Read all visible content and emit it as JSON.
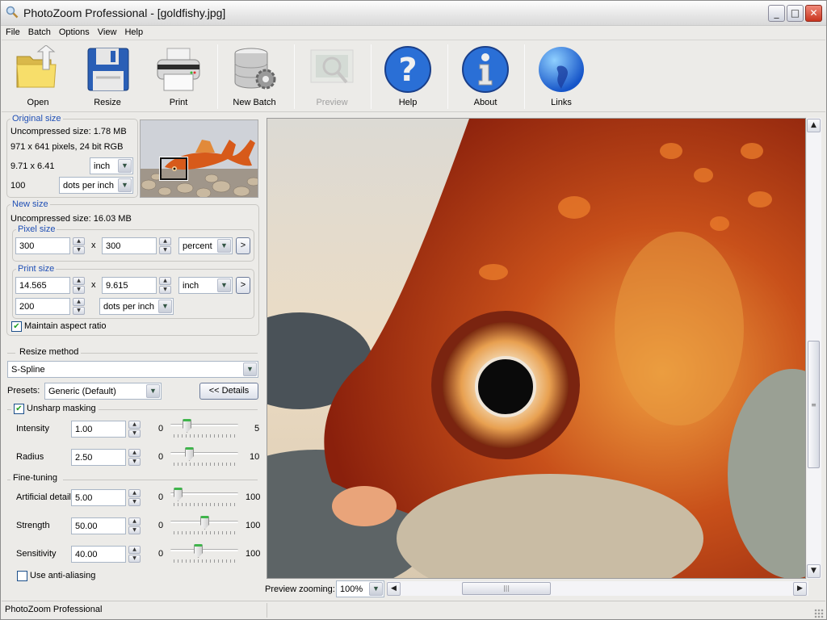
{
  "window": {
    "title": "PhotoZoom Professional - [goldfishy.jpg]",
    "controls": {
      "minimize": "_",
      "maximize": "□",
      "close": "✕"
    }
  },
  "menu": [
    "File",
    "Batch",
    "Options",
    "View",
    "Help"
  ],
  "toolbar": [
    {
      "label": "Open",
      "icon": "folder-open-icon",
      "enabled": true
    },
    {
      "label": "Resize",
      "icon": "floppy-disk-icon",
      "enabled": true
    },
    {
      "label": "Print",
      "icon": "printer-icon",
      "enabled": true
    },
    {
      "label": "New Batch",
      "icon": "database-gear-icon",
      "enabled": true
    },
    {
      "label": "Preview",
      "icon": "preview-magnifier-icon",
      "enabled": false
    },
    {
      "label": "Help",
      "icon": "help-question-icon",
      "enabled": true
    },
    {
      "label": "About",
      "icon": "info-icon",
      "enabled": true
    },
    {
      "label": "Links",
      "icon": "globe-icon",
      "enabled": true
    }
  ],
  "original_size": {
    "legend": "Original size",
    "uncompressed": "Uncompressed size: 1.78 MB",
    "pixels": "971 x 641 pixels, 24 bit RGB",
    "dimensions": "9.71 x 6.41",
    "unit": "inch",
    "resolution": "100",
    "resolution_unit": "dots per inch"
  },
  "new_size": {
    "legend": "New size",
    "uncompressed": "Uncompressed size: 16.03 MB",
    "pixel_size": {
      "legend": "Pixel size",
      "width": "300",
      "height": "300",
      "x_label": "x",
      "unit": "percent",
      "more": ">"
    },
    "print_size": {
      "legend": "Print size",
      "width": "14.565",
      "height": "9.615",
      "x_label": "x",
      "unit": "inch",
      "more": ">",
      "resolution": "200",
      "resolution_unit": "dots per inch"
    },
    "maintain_aspect": {
      "label": "Maintain aspect ratio",
      "checked": true
    }
  },
  "resize_method": {
    "heading": "Resize method",
    "value": "S-Spline",
    "presets_label": "Presets:",
    "preset_value": "Generic (Default)",
    "details_button": "<< Details"
  },
  "unsharp": {
    "label": "Unsharp masking",
    "checked": true,
    "params": [
      {
        "label": "Intensity",
        "value": "1.00",
        "min": "0",
        "max": "5",
        "fraction": 0.2
      },
      {
        "label": "Radius",
        "value": "2.50",
        "min": "0",
        "max": "10",
        "fraction": 0.25
      }
    ]
  },
  "fine_tuning": {
    "heading": "Fine-tuning",
    "params": [
      {
        "label": "Artificial detail",
        "value": "5.00",
        "min": "0",
        "max": "100",
        "fraction": 0.05
      },
      {
        "label": "Strength",
        "value": "50.00",
        "min": "0",
        "max": "100",
        "fraction": 0.5
      },
      {
        "label": "Sensitivity",
        "value": "40.00",
        "min": "0",
        "max": "100",
        "fraction": 0.4
      }
    ],
    "anti_aliasing": {
      "label": "Use anti-aliasing",
      "checked": false
    }
  },
  "preview": {
    "zoom_label": "Preview zooming:",
    "zoom_value": "100%"
  },
  "status": {
    "text": "PhotoZoom Professional"
  }
}
